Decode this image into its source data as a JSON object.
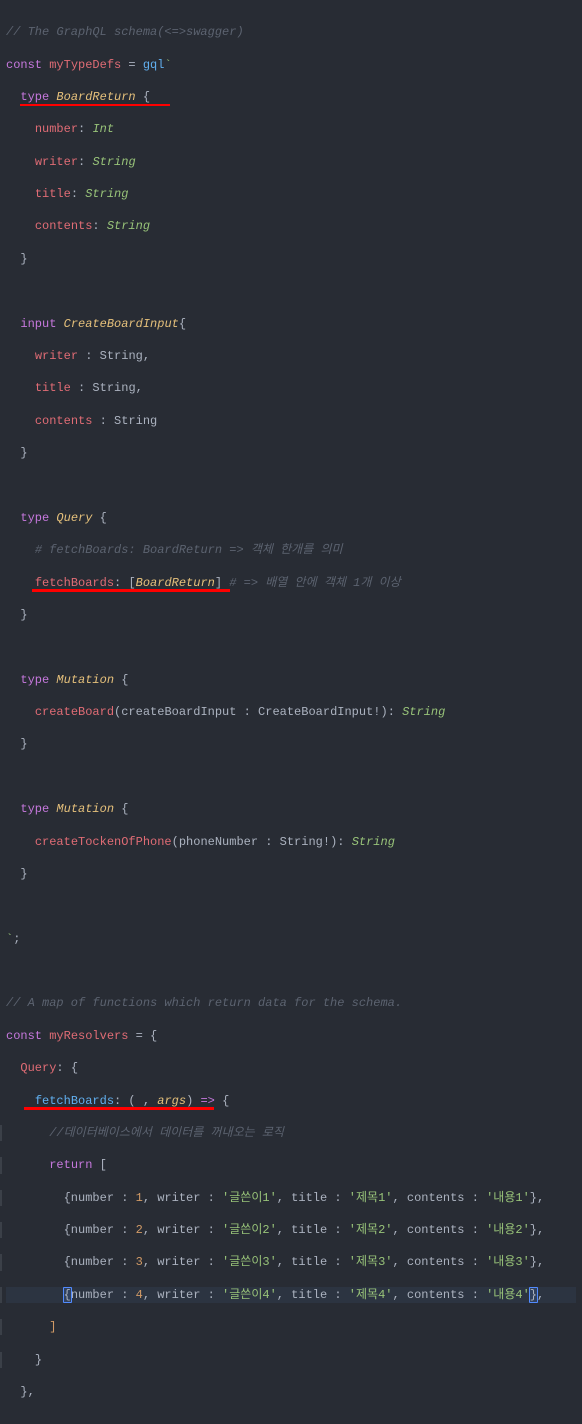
{
  "code": {
    "l1": "// The GraphQL schema(<=>swagger)",
    "l2_const": "const",
    "l2_name": "myTypeDefs",
    "l2_eq": " = ",
    "l2_gql": "gql",
    "l2_tick": "`",
    "l3_type": "type",
    "l3_name": "BoardReturn",
    "l3_brace": " {",
    "l4_field": "number",
    "l4_colon": ": ",
    "l4_type": "Int",
    "l5_field": "writer",
    "l5_colon": ": ",
    "l5_type": "String",
    "l6_field": "title",
    "l6_colon": ": ",
    "l6_type": "String",
    "l7_field": "contents",
    "l7_colon": ": ",
    "l7_type": "String",
    "l8_brace": "}",
    "l10_input": "input",
    "l10_name": "CreateBoardInput",
    "l10_brace": "{",
    "l11_field": "writer",
    "l11_rest": " : String,",
    "l12_field": "title",
    "l12_rest": " : String,",
    "l13_field": "contents",
    "l13_rest": " : String",
    "l14_brace": "}",
    "l16_type": "type",
    "l16_name": "Query",
    "l16_brace": " {",
    "l17": "# fetchBoards: BoardReturn => 객체 한개를 의미",
    "l18_field": "fetchBoards",
    "l18_colon": ": ",
    "l18_br1": "[",
    "l18_type": "BoardReturn",
    "l18_br2": "]",
    "l18_rest": " # => 배열 안에 객체 1개 이상",
    "l19_brace": "}",
    "l21_type": "type",
    "l21_name": "Mutation",
    "l21_brace": " {",
    "l22_field": "createBoard",
    "l22_p1": "(createBoardInput : CreateBoardInput!)",
    "l22_colon": ": ",
    "l22_type": "String",
    "l23_brace": "}",
    "l25_type": "type",
    "l25_name": "Mutation",
    "l25_brace": " {",
    "l26_field": "createTockenOfPhone",
    "l26_p1": "(phoneNumber : String!)",
    "l26_colon": ": ",
    "l26_type": "String",
    "l27_brace": "}",
    "l29_tick": "`",
    "l29_semi": ";",
    "l31": "// A map of functions which return data for the schema.",
    "l32_const": "const",
    "l32_name": "myResolvers",
    "l32_rest": " = {",
    "l33_q": "Query",
    "l33_rest": ": {",
    "l34_fb": "fetchBoards",
    "l34_p1": ": ( , ",
    "l34_args": "args",
    "l34_p2": ") ",
    "l34_arrow": "=>",
    "l34_brace": " {",
    "l35": "//데이터베이스에서 데이터를 꺼내오는 로직",
    "l36_return": "return",
    "l36_br": " [",
    "row1_a": "{number : ",
    "row1_n": "1",
    "row1_b": ", writer : ",
    "row1_s1": "'글쓴이1'",
    "row1_c": ", title : ",
    "row1_s2": "'제목1'",
    "row1_d": ", contents : ",
    "row1_s3": "'내용1'",
    "row1_e": "},",
    "row2_a": "{number : ",
    "row2_n": "2",
    "row2_b": ", writer : ",
    "row2_s1": "'글쓴이2'",
    "row2_c": ", title : ",
    "row2_s2": "'제목2'",
    "row2_d": ", contents : ",
    "row2_s3": "'내용2'",
    "row2_e": "},",
    "row3_a": "{number : ",
    "row3_n": "3",
    "row3_b": ", writer : ",
    "row3_s1": "'글쓴이3'",
    "row3_c": ", title : ",
    "row3_s2": "'제목3'",
    "row3_d": ", contents : ",
    "row3_s3": "'내용3'",
    "row3_e": "},",
    "row4_a": "{number : ",
    "row4_n": "4",
    "row4_b": ", writer : ",
    "row4_s1": "'글쓴이4'",
    "row4_c": ", title : ",
    "row4_s2": "'제목4'",
    "row4_d": ", contents : ",
    "row4_s3": "'내용4'",
    "row4_e": "},",
    "l41_br": "]",
    "l42_brace": "}",
    "l43_brace": "},"
  }
}
